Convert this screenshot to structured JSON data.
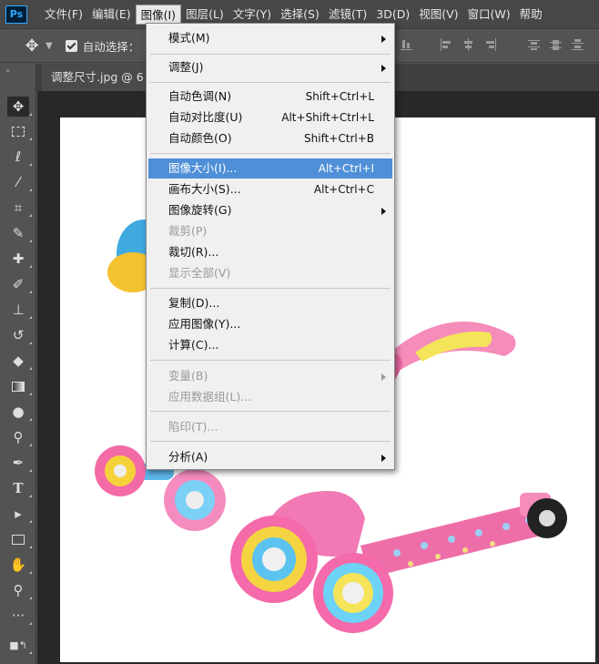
{
  "app": {
    "logo": "Ps"
  },
  "menubar": {
    "items": [
      "文件(F)",
      "编辑(E)",
      "图像(I)",
      "图层(L)",
      "文字(Y)",
      "选择(S)",
      "滤镜(T)",
      "3D(D)",
      "视图(V)",
      "窗口(W)",
      "帮助"
    ]
  },
  "options": {
    "autoselect_label": "自动选择："
  },
  "document": {
    "tab_title": "调整尺寸.jpg @ 6"
  },
  "toolbar": {
    "collapse": "»"
  },
  "image_menu": {
    "items": [
      {
        "label": "模式(M)",
        "shortcut": "",
        "submenu": true,
        "disabled": false
      },
      {
        "label": "调整(J)",
        "shortcut": "",
        "submenu": true,
        "disabled": false
      },
      {
        "label": "自动色调(N)",
        "shortcut": "Shift+Ctrl+L",
        "submenu": false,
        "disabled": false
      },
      {
        "label": "自动对比度(U)",
        "shortcut": "Alt+Shift+Ctrl+L",
        "submenu": false,
        "disabled": false
      },
      {
        "label": "自动颜色(O)",
        "shortcut": "Shift+Ctrl+B",
        "submenu": false,
        "disabled": false
      },
      {
        "label": "图像大小(I)...",
        "shortcut": "Alt+Ctrl+I",
        "submenu": false,
        "disabled": false,
        "highlighted": true
      },
      {
        "label": "画布大小(S)...",
        "shortcut": "Alt+Ctrl+C",
        "submenu": false,
        "disabled": false
      },
      {
        "label": "图像旋转(G)",
        "shortcut": "",
        "submenu": true,
        "disabled": false
      },
      {
        "label": "裁剪(P)",
        "shortcut": "",
        "submenu": false,
        "disabled": true
      },
      {
        "label": "裁切(R)...",
        "shortcut": "",
        "submenu": false,
        "disabled": false
      },
      {
        "label": "显示全部(V)",
        "shortcut": "",
        "submenu": false,
        "disabled": true
      },
      {
        "label": "复制(D)...",
        "shortcut": "",
        "submenu": false,
        "disabled": false
      },
      {
        "label": "应用图像(Y)...",
        "shortcut": "",
        "submenu": false,
        "disabled": false
      },
      {
        "label": "计算(C)...",
        "shortcut": "",
        "submenu": false,
        "disabled": false
      },
      {
        "label": "变量(B)",
        "shortcut": "",
        "submenu": true,
        "disabled": true
      },
      {
        "label": "应用数据组(L)...",
        "shortcut": "",
        "submenu": false,
        "disabled": true
      },
      {
        "label": "陷印(T)...",
        "shortcut": "",
        "submenu": false,
        "disabled": true
      },
      {
        "label": "分析(A)",
        "shortcut": "",
        "submenu": true,
        "disabled": false
      }
    ]
  },
  "colors": {
    "highlight": "#4f8fd7",
    "menu_bg": "#f0f0f0",
    "app_bg": "#535353",
    "canvas_bg": "#282828"
  },
  "icons": [
    "move-icon",
    "marquee-icon",
    "lasso-icon",
    "magic-wand-icon",
    "crop-icon",
    "eyedropper-icon",
    "healing-brush-icon",
    "brush-icon",
    "clone-stamp-icon",
    "history-brush-icon",
    "eraser-icon",
    "gradient-icon",
    "blur-icon",
    "dodge-icon",
    "pen-icon",
    "type-icon",
    "path-selection-icon",
    "rectangle-icon",
    "hand-icon",
    "zoom-icon",
    "more-tools-icon",
    "swap-colors-icon"
  ]
}
